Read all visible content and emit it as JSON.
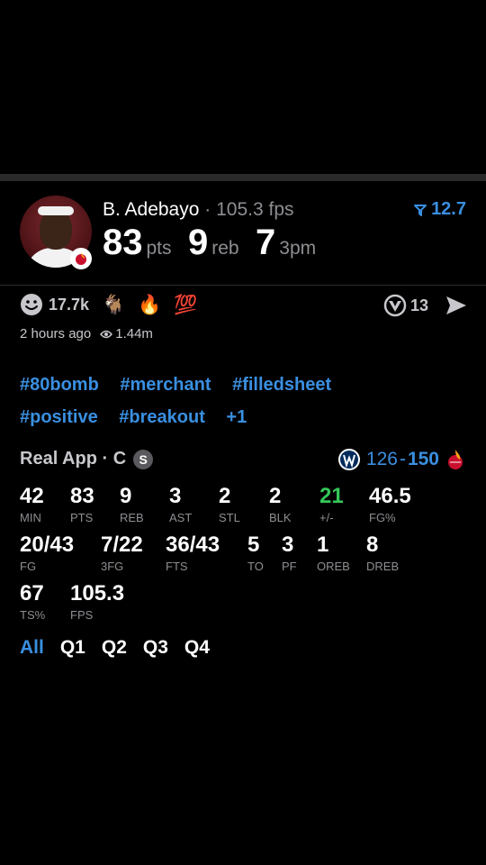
{
  "player": {
    "name": "B. Adebayo",
    "separator": "·",
    "fps": "105.3 fps",
    "points": "83",
    "points_unit": "pts",
    "rebounds": "9",
    "rebounds_unit": "reb",
    "threes": "7",
    "threes_unit": "3pm"
  },
  "rating": {
    "value": "12.7"
  },
  "reactions": {
    "count": "17.7k",
    "emojis": [
      "🐐",
      "🔥",
      "💯"
    ],
    "comments": "13"
  },
  "meta": {
    "time": "2 hours ago",
    "views": "1.44m"
  },
  "tags": [
    "#80bomb",
    "#merchant",
    "#filledsheet",
    "#positive",
    "#breakout",
    "+1"
  ],
  "source": {
    "label": "Real App · C",
    "badge": "S"
  },
  "game": {
    "away_score": "126",
    "dash": "-",
    "home_score": "150"
  },
  "stats": [
    {
      "value": "42",
      "label": "MIN"
    },
    {
      "value": "83",
      "label": "PTS"
    },
    {
      "value": "9",
      "label": "REB"
    },
    {
      "value": "3",
      "label": "AST"
    },
    {
      "value": "2",
      "label": "STL"
    },
    {
      "value": "2",
      "label": "BLK"
    },
    {
      "value": "21",
      "label": "+/-"
    },
    {
      "value": "46.5",
      "label": "FG%"
    },
    {
      "value": "20/43",
      "label": "FG"
    },
    {
      "value": "7/22",
      "label": "3FG"
    },
    {
      "value": "36/43",
      "label": "FTS"
    },
    {
      "value": "5",
      "label": "TO"
    },
    {
      "value": "3",
      "label": "PF"
    },
    {
      "value": "1",
      "label": "OREB"
    },
    {
      "value": "8",
      "label": "DREB"
    },
    {
      "value": "67",
      "label": "TS%"
    },
    {
      "value": "105.3",
      "label": "FPS"
    }
  ],
  "quarters": [
    "All",
    "Q1",
    "Q2",
    "Q3",
    "Q4"
  ],
  "colors": {
    "accent": "#3a8fe0",
    "positive": "#34c759",
    "muted": "#8e8e93"
  },
  "icons": [
    "smiley-icon",
    "filter-icon",
    "comment-icon",
    "send-icon",
    "eye-icon",
    "wizards-logo-icon",
    "heat-logo-icon"
  ]
}
